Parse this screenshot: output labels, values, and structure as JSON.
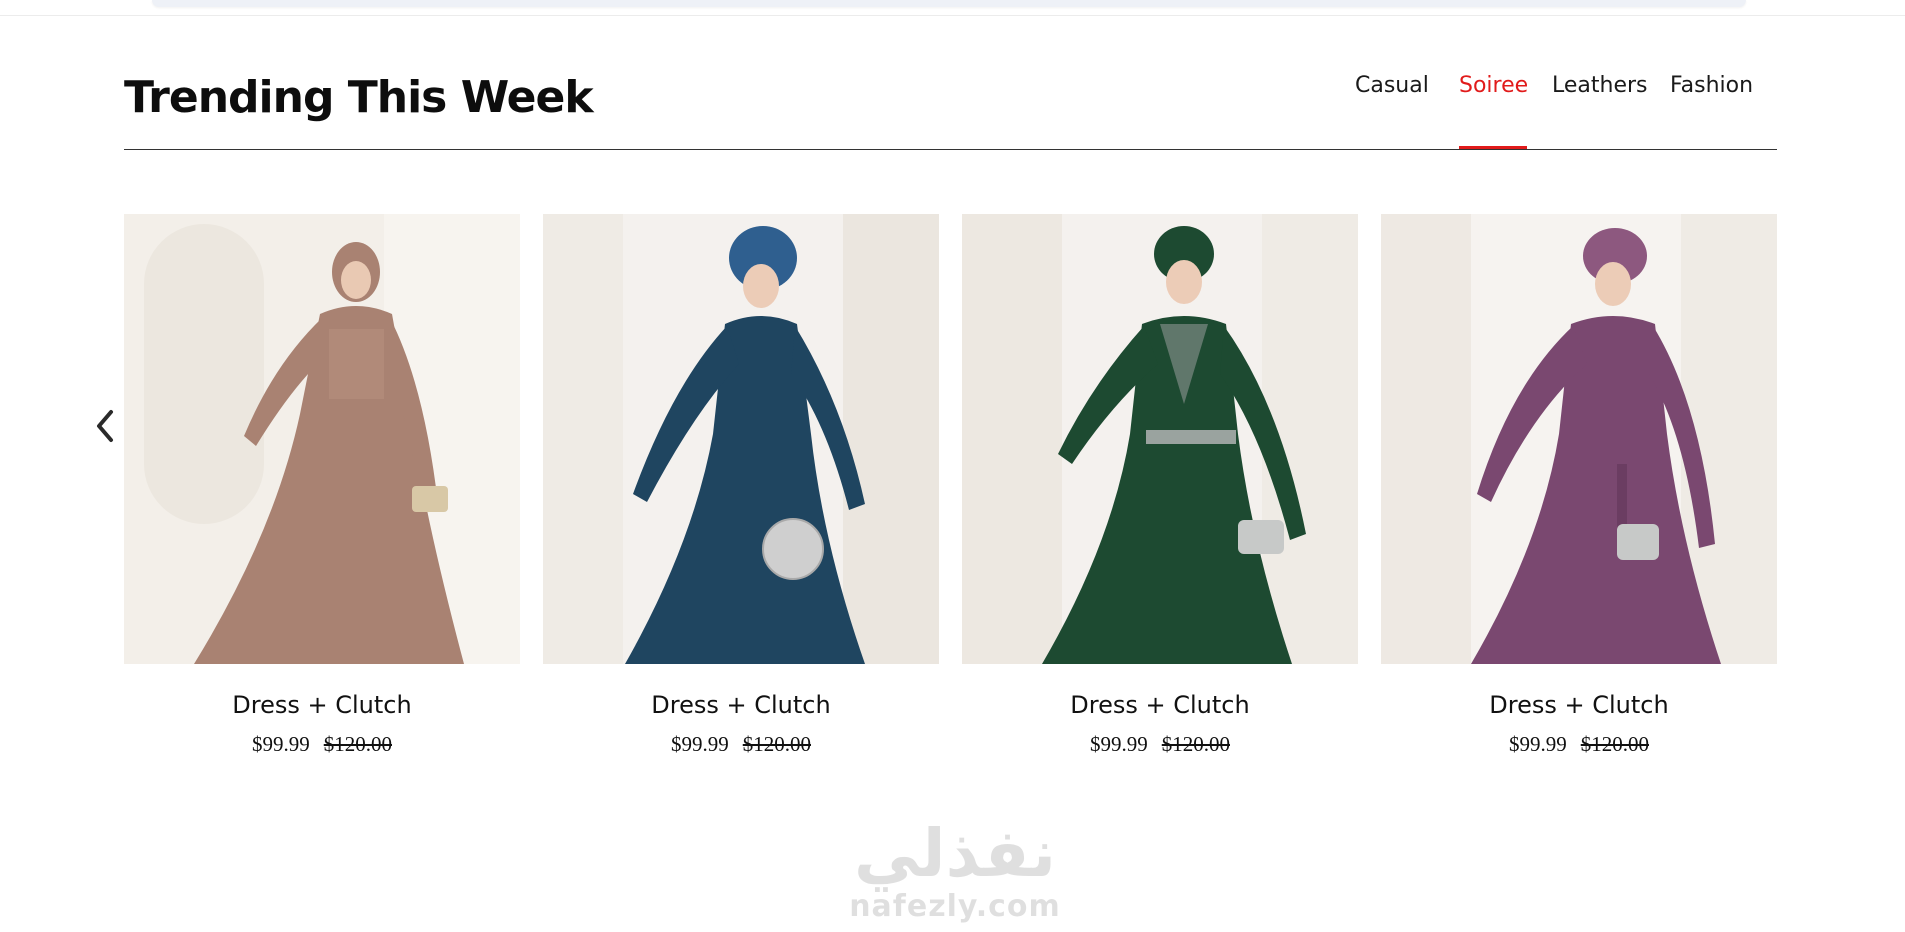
{
  "section": {
    "title": "Trending This Week"
  },
  "tabs": [
    {
      "label": "Casual",
      "active": false
    },
    {
      "label": "Soiree",
      "active": true
    },
    {
      "label": "Leathers",
      "active": false
    },
    {
      "label": "Fashion",
      "active": false
    }
  ],
  "colors": {
    "accent": "#e11b1b",
    "text": "#111111"
  },
  "carousel": {
    "prev_icon": "chevron-left-icon"
  },
  "products": [
    {
      "name": "Dress + Clutch",
      "price": "$99.99",
      "old_price": "$120.00",
      "dress_color": "#a98272"
    },
    {
      "name": "Dress + Clutch",
      "price": "$99.99",
      "old_price": "$120.00",
      "dress_color": "#1f4560"
    },
    {
      "name": "Dress + Clutch",
      "price": "$99.99",
      "old_price": "$120.00",
      "dress_color": "#1d4a31"
    },
    {
      "name": "Dress + Clutch",
      "price": "$99.99",
      "old_price": "$120.00",
      "dress_color": "#7a4870"
    }
  ],
  "watermark": {
    "arabic": "نفذلي",
    "latin": "nafezly.com"
  }
}
